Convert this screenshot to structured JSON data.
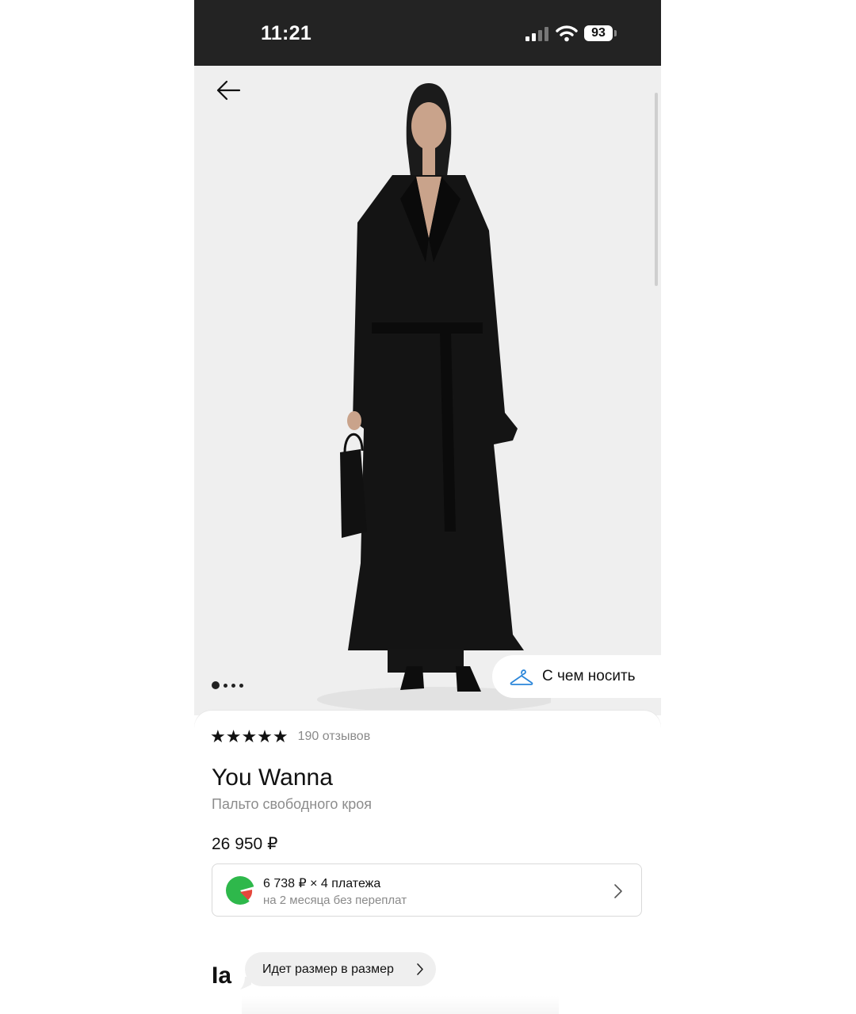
{
  "status_bar": {
    "time": "11:21",
    "battery": "93"
  },
  "gallery": {
    "outfit_button_label": "С чем носить",
    "page_count": 4,
    "active_page": 1
  },
  "product": {
    "rating_stars": "★★★★★",
    "rating": 5,
    "reviews": "190 отзывов",
    "brand": "You Wanna",
    "subtitle": "Пальто свободного кроя",
    "price": "26 950 ₽"
  },
  "installment": {
    "line1": "6 738 ₽ × 4 платежа",
    "line2": "на 2 месяца без переплат"
  },
  "size_section": {
    "title_fragment": "Ia",
    "fit_hint": "Идет размер в размер"
  },
  "colors": {
    "status_bar_bg": "#232323",
    "accent_hanger": "#2b86d9",
    "installment_logo": "#2eb84b"
  },
  "icons": [
    "back-arrow-icon",
    "hanger-icon",
    "chevron-right-icon",
    "signal-icon",
    "wifi-icon"
  ]
}
